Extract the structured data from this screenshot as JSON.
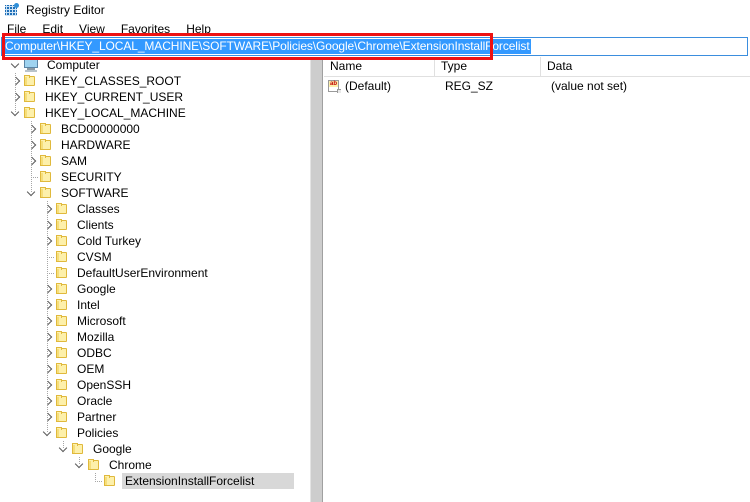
{
  "window": {
    "title": "Registry Editor",
    "icon": "registry-editor-icon"
  },
  "menubar": {
    "items": [
      {
        "label": "File"
      },
      {
        "label": "Edit"
      },
      {
        "label": "View"
      },
      {
        "label": "Favorites"
      },
      {
        "label": "Help"
      }
    ]
  },
  "address": {
    "value": "Computer\\HKEY_LOCAL_MACHINE\\SOFTWARE\\Policies\\Google\\Chrome\\ExtensionInstallForcelist",
    "selected": true,
    "highlight_color": "#3399ff"
  },
  "annotation": {
    "shape": "rectangle",
    "color": "#ee1111"
  },
  "tree": {
    "nodes": [
      {
        "label": "Computer",
        "depth": 0,
        "state": "open",
        "icon": "monitor-icon",
        "selected": false
      },
      {
        "label": "HKEY_CLASSES_ROOT",
        "depth": 1,
        "state": "closed",
        "icon": "folder-icon",
        "selected": false
      },
      {
        "label": "HKEY_CURRENT_USER",
        "depth": 1,
        "state": "closed",
        "icon": "folder-icon",
        "selected": false
      },
      {
        "label": "HKEY_LOCAL_MACHINE",
        "depth": 1,
        "state": "open",
        "icon": "folder-icon",
        "selected": false
      },
      {
        "label": "BCD00000000",
        "depth": 2,
        "state": "closed",
        "icon": "folder-icon",
        "selected": false
      },
      {
        "label": "HARDWARE",
        "depth": 2,
        "state": "closed",
        "icon": "folder-icon",
        "selected": false
      },
      {
        "label": "SAM",
        "depth": 2,
        "state": "closed",
        "icon": "folder-icon",
        "selected": false
      },
      {
        "label": "SECURITY",
        "depth": 2,
        "state": "leaf",
        "icon": "folder-icon",
        "selected": false
      },
      {
        "label": "SOFTWARE",
        "depth": 2,
        "state": "open",
        "icon": "folder-icon",
        "selected": false
      },
      {
        "label": "Classes",
        "depth": 3,
        "state": "closed",
        "icon": "folder-icon",
        "selected": false
      },
      {
        "label": "Clients",
        "depth": 3,
        "state": "closed",
        "icon": "folder-icon",
        "selected": false
      },
      {
        "label": "Cold Turkey",
        "depth": 3,
        "state": "closed",
        "icon": "folder-icon",
        "selected": false
      },
      {
        "label": "CVSM",
        "depth": 3,
        "state": "leaf",
        "icon": "folder-icon",
        "selected": false
      },
      {
        "label": "DefaultUserEnvironment",
        "depth": 3,
        "state": "leaf",
        "icon": "folder-icon",
        "selected": false
      },
      {
        "label": "Google",
        "depth": 3,
        "state": "closed",
        "icon": "folder-icon",
        "selected": false
      },
      {
        "label": "Intel",
        "depth": 3,
        "state": "closed",
        "icon": "folder-icon",
        "selected": false
      },
      {
        "label": "Microsoft",
        "depth": 3,
        "state": "closed",
        "icon": "folder-icon",
        "selected": false
      },
      {
        "label": "Mozilla",
        "depth": 3,
        "state": "closed",
        "icon": "folder-icon",
        "selected": false
      },
      {
        "label": "ODBC",
        "depth": 3,
        "state": "closed",
        "icon": "folder-icon",
        "selected": false
      },
      {
        "label": "OEM",
        "depth": 3,
        "state": "closed",
        "icon": "folder-icon",
        "selected": false
      },
      {
        "label": "OpenSSH",
        "depth": 3,
        "state": "closed",
        "icon": "folder-icon",
        "selected": false
      },
      {
        "label": "Oracle",
        "depth": 3,
        "state": "closed",
        "icon": "folder-icon",
        "selected": false
      },
      {
        "label": "Partner",
        "depth": 3,
        "state": "closed",
        "icon": "folder-icon",
        "selected": false
      },
      {
        "label": "Policies",
        "depth": 3,
        "state": "open",
        "icon": "folder-icon",
        "selected": false
      },
      {
        "label": "Google",
        "depth": 4,
        "state": "open",
        "icon": "folder-icon",
        "selected": false
      },
      {
        "label": "Chrome",
        "depth": 5,
        "state": "open",
        "icon": "folder-icon",
        "selected": false
      },
      {
        "label": "ExtensionInstallForcelist",
        "depth": 6,
        "state": "leaf",
        "icon": "folder-icon",
        "selected": true
      }
    ]
  },
  "list": {
    "columns": [
      {
        "label": "Name"
      },
      {
        "label": "Type"
      },
      {
        "label": "Data"
      }
    ],
    "rows": [
      {
        "name": "(Default)",
        "type": "REG_SZ",
        "data": "(value not set)",
        "icon": "string-value-icon"
      }
    ]
  }
}
